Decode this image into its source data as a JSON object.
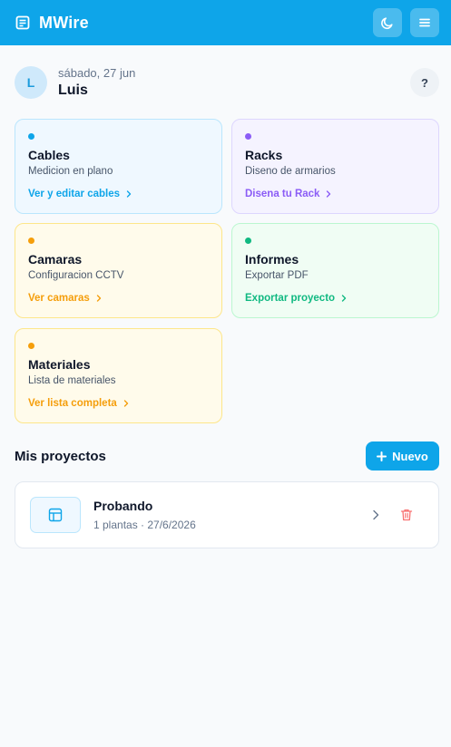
{
  "header": {
    "title": "MWire",
    "brand_icon": "document-icon",
    "theme_icon": "moon-icon",
    "menu_icon": "hamburger-menu-icon"
  },
  "greeting": {
    "avatar_initial": "L",
    "date": "sábado, 27 jun",
    "name": "Luis",
    "help_label": "?"
  },
  "cards": [
    {
      "title": "Cables",
      "subtitle": "Medicion en plano",
      "link": "Ver y editar cables",
      "color": "#0ea5e9"
    },
    {
      "title": "Racks",
      "subtitle": "Diseno de armarios",
      "link": "Disena tu Rack",
      "color": "#8b5cf6"
    },
    {
      "title": "Camaras",
      "subtitle": "Configuracion CCTV",
      "link": "Ver camaras",
      "color": "#f59e0b"
    },
    {
      "title": "Informes",
      "subtitle": "Exportar PDF",
      "link": "Exportar proyecto",
      "color": "#10b981"
    },
    {
      "title": "Materiales",
      "subtitle": "Lista de materiales",
      "link": "Ver lista completa",
      "color": "#f59e0b"
    }
  ],
  "projects": {
    "heading": "Mis proyectos",
    "new_button": "Nuevo",
    "items": [
      {
        "name": "Probando",
        "meta": "1 plantas · 27/6/2026"
      }
    ]
  }
}
